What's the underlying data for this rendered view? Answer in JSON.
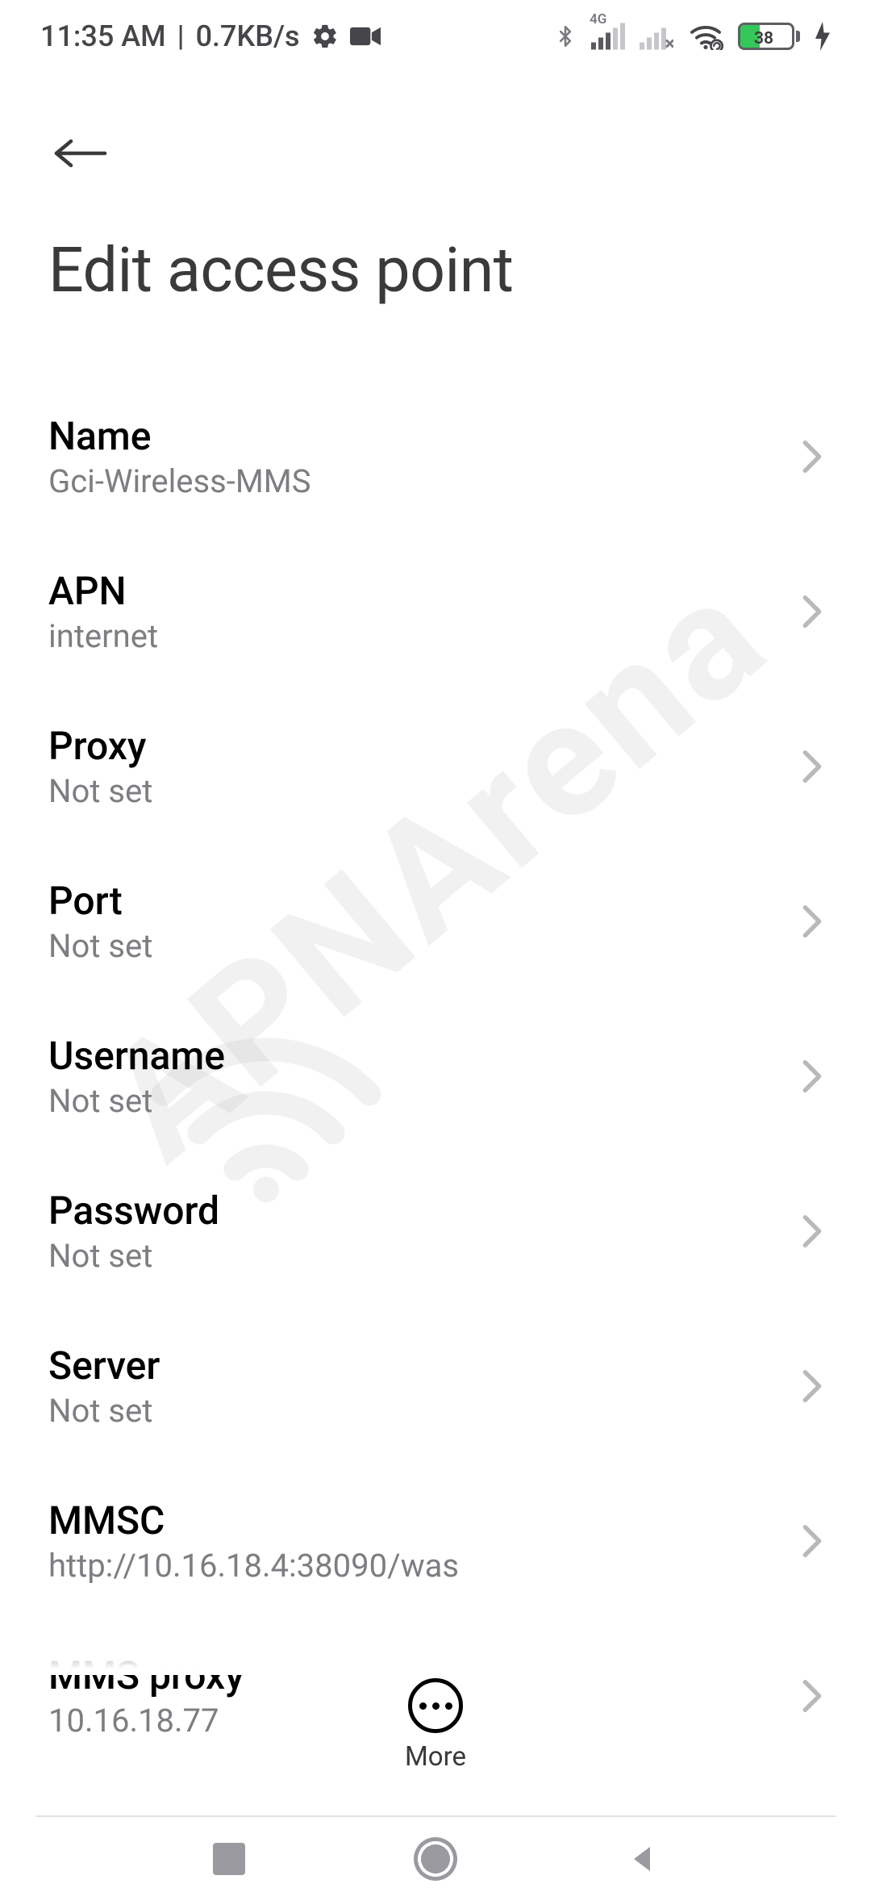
{
  "status": {
    "time": "11:35 AM",
    "speed": "0.7KB/s",
    "battery_percent": "38",
    "signal_label": "4G"
  },
  "page": {
    "title": "Edit access point",
    "more_label": "More"
  },
  "watermark": {
    "text": "APNArena"
  },
  "rows": [
    {
      "label": "Name",
      "value": "Gci-Wireless-MMS"
    },
    {
      "label": "APN",
      "value": "internet"
    },
    {
      "label": "Proxy",
      "value": "Not set"
    },
    {
      "label": "Port",
      "value": "Not set"
    },
    {
      "label": "Username",
      "value": "Not set"
    },
    {
      "label": "Password",
      "value": "Not set"
    },
    {
      "label": "Server",
      "value": "Not set"
    },
    {
      "label": "MMSC",
      "value": "http://10.16.18.4:38090/was"
    },
    {
      "label": "MMS proxy",
      "value": "10.16.18.77"
    }
  ]
}
